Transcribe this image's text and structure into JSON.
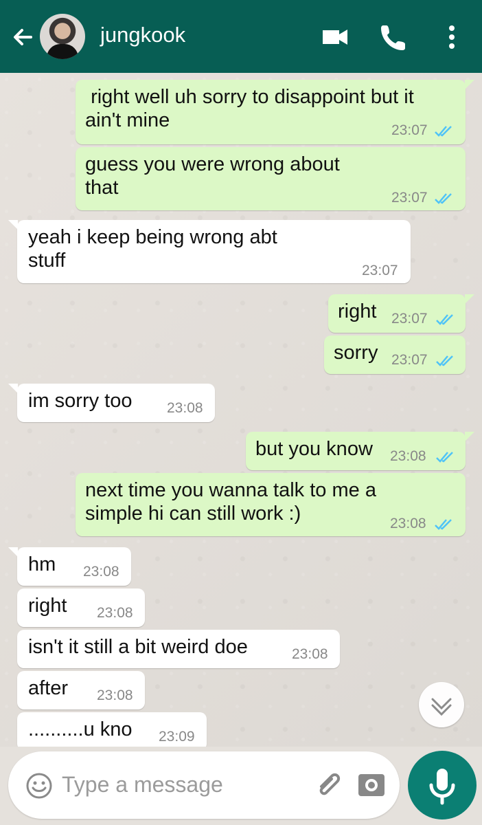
{
  "header": {
    "contact_name": "jungkook",
    "icons": [
      "back-arrow-icon",
      "video-call-icon",
      "phone-icon",
      "more-vert-icon"
    ]
  },
  "messages": [
    {
      "direction": "out",
      "text": " right well uh sorry to disappoint but it\nain't mine",
      "time": "23:07",
      "status": "read"
    },
    {
      "direction": "out",
      "text": "guess you were wrong about\nthat",
      "time": "23:07",
      "status": "read"
    },
    {
      "direction": "in",
      "text": "yeah i keep being wrong abt\nstuff",
      "time": "23:07"
    },
    {
      "direction": "out",
      "text": "right",
      "time": "23:07",
      "status": "read"
    },
    {
      "direction": "out",
      "text": "sorry",
      "time": "23:07",
      "status": "read"
    },
    {
      "direction": "in",
      "text": "im sorry too",
      "time": "23:08"
    },
    {
      "direction": "out",
      "text": "but you know",
      "time": "23:08",
      "status": "read"
    },
    {
      "direction": "out",
      "text": "next time you wanna talk to me a\nsimple hi can still work :)",
      "time": "23:08",
      "status": "read"
    },
    {
      "direction": "in",
      "text": "hm",
      "time": "23:08"
    },
    {
      "direction": "in",
      "text": "right",
      "time": "23:08"
    },
    {
      "direction": "in",
      "text": "isn't it still a bit weird doe",
      "time": "23:08"
    },
    {
      "direction": "in",
      "text": "after",
      "time": "23:08"
    },
    {
      "direction": "in",
      "text": "..........u kno",
      "time": "23:09"
    }
  ],
  "composer": {
    "placeholder": "Type a message",
    "icons": [
      "emoji-icon",
      "attachment-icon",
      "camera-icon",
      "microphone-icon"
    ]
  },
  "colors": {
    "header": "#075e54",
    "outgoing": "#dcf8c6",
    "incoming": "#ffffff",
    "read_ticks": "#4fc3f7",
    "mic_button": "#0b7f73"
  }
}
